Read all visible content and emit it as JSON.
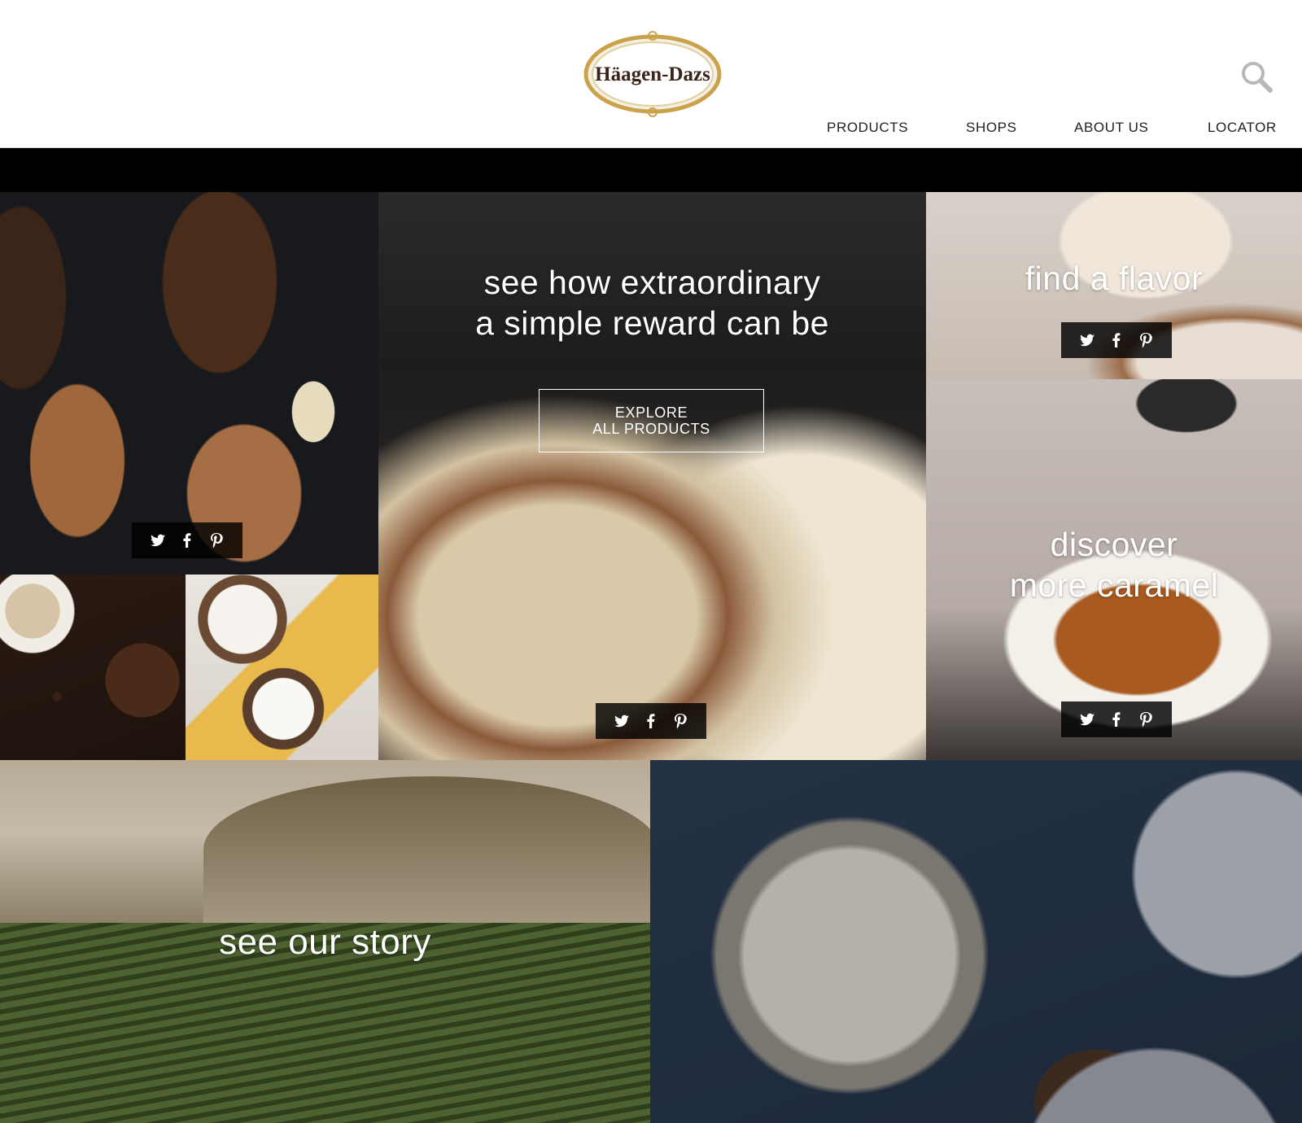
{
  "header": {
    "logo_text": "Häagen-Dazs",
    "nav": [
      "PRODUCTS",
      "SHOPS",
      "ABOUT US",
      "LOCATOR"
    ]
  },
  "hero": {
    "title_line1": "see how extraordinary",
    "title_line2": "a simple reward can be",
    "button_line1": "EXPLORE",
    "button_line2": "ALL PRODUCTS"
  },
  "tiles": {
    "flavor_title": "find a flavor",
    "caramel_line1": "discover",
    "caramel_line2": "more caramel",
    "story_title": "see our story"
  },
  "social_icons": [
    "twitter-icon",
    "facebook-icon",
    "pinterest-icon"
  ],
  "colors": {
    "overlay": "#000000",
    "logo_gold": "#c9a24a",
    "logo_brown": "#3a2418"
  }
}
